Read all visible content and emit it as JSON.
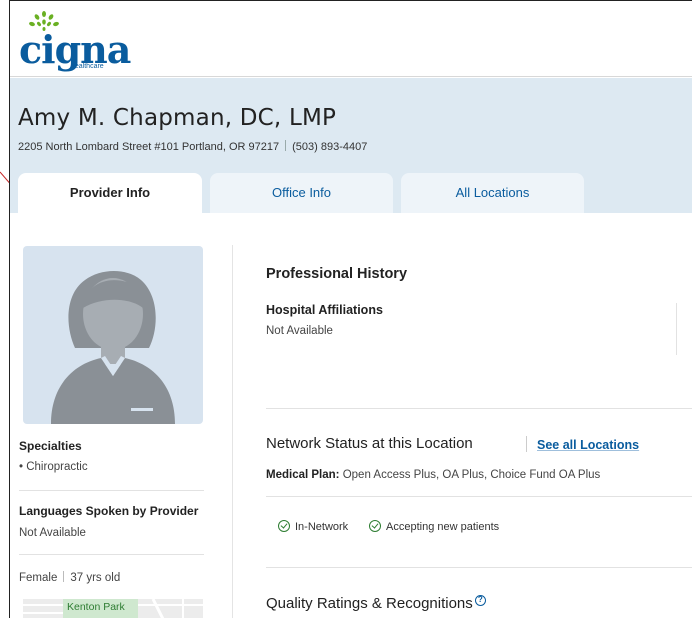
{
  "brand": {
    "name": "cigna",
    "sub": "healthcare",
    "color": "#0a5c9e"
  },
  "provider": {
    "name": "Amy M. Chapman, DC, LMP",
    "address": "2205 North Lombard Street #101 Portland, OR 97217",
    "phone": "(503) 893-4407"
  },
  "tabs": [
    {
      "label": "Provider Info",
      "active": true
    },
    {
      "label": "Office Info",
      "active": false
    },
    {
      "label": "All Locations",
      "active": false
    }
  ],
  "sidebar": {
    "specialties_title": "Specialties",
    "specialties": [
      "Chiropractic"
    ],
    "languages_title": "Languages Spoken by Provider",
    "languages_value": "Not Available",
    "gender": "Female",
    "age": "37 yrs old",
    "map_label": "Kenton Park"
  },
  "main": {
    "history_title": "Professional History",
    "hospital_title": "Hospital Affiliations",
    "hospital_value": "Not Available",
    "network_title": "Network Status at this Location",
    "see_all_link": "See all Locations",
    "plan_label": "Medical Plan:",
    "plan_value": "Open Access Plus, OA Plus, Choice Fund OA Plus",
    "status_items": [
      "In-Network",
      "Accepting new patients"
    ],
    "quality_title": "Quality Ratings & Recognitions",
    "quality_help_icon": "question-circle-icon"
  }
}
